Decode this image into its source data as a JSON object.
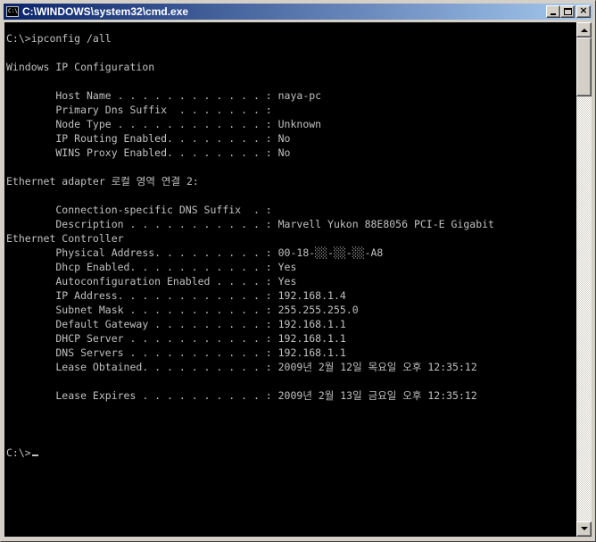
{
  "window": {
    "title": "C:\\WINDOWS\\system32\\cmd.exe",
    "icon_text": "C:\\"
  },
  "caption_buttons": [
    {
      "name": "minimize-icon"
    },
    {
      "name": "maximize-icon"
    },
    {
      "name": "close-icon",
      "label": "×"
    }
  ],
  "console": {
    "lines": [
      "C:\\>ipconfig /all",
      "",
      "Windows IP Configuration",
      "",
      "        Host Name . . . . . . . . . . . . : naya-pc",
      "        Primary Dns Suffix  . . . . . . . :",
      "        Node Type . . . . . . . . . . . . : Unknown",
      "        IP Routing Enabled. . . . . . . . : No",
      "        WINS Proxy Enabled. . . . . . . . : No",
      "",
      "Ethernet adapter 로컬 영역 연결 2:",
      "",
      "        Connection-specific DNS Suffix  . :",
      "        Description . . . . . . . . . . . : Marvell Yukon 88E8056 PCI-E Gigabit",
      "Ethernet Controller",
      "        Physical Address. . . . . . . . . : 00-18-░░-░░-░░-A8",
      "        Dhcp Enabled. . . . . . . . . . . : Yes",
      "        Autoconfiguration Enabled . . . . : Yes",
      "        IP Address. . . . . . . . . . . . : 192.168.1.4",
      "        Subnet Mask . . . . . . . . . . . : 255.255.255.0",
      "        Default Gateway . . . . . . . . . : 192.168.1.1",
      "        DHCP Server . . . . . . . . . . . : 192.168.1.1",
      "        DNS Servers . . . . . . . . . . . : 192.168.1.1",
      "        Lease Obtained. . . . . . . . . . : 2009년 2월 12일 목요일 오후 12:35:12",
      "",
      "        Lease Expires . . . . . . . . . . : 2009년 2월 13일 금요일 오후 12:35:12",
      "",
      "",
      ""
    ],
    "prompt": "C:\\>",
    "colors": {
      "background": "#000000",
      "text": "#c0c0c0"
    }
  },
  "scrollbar": {
    "position_fraction": 0.0
  }
}
